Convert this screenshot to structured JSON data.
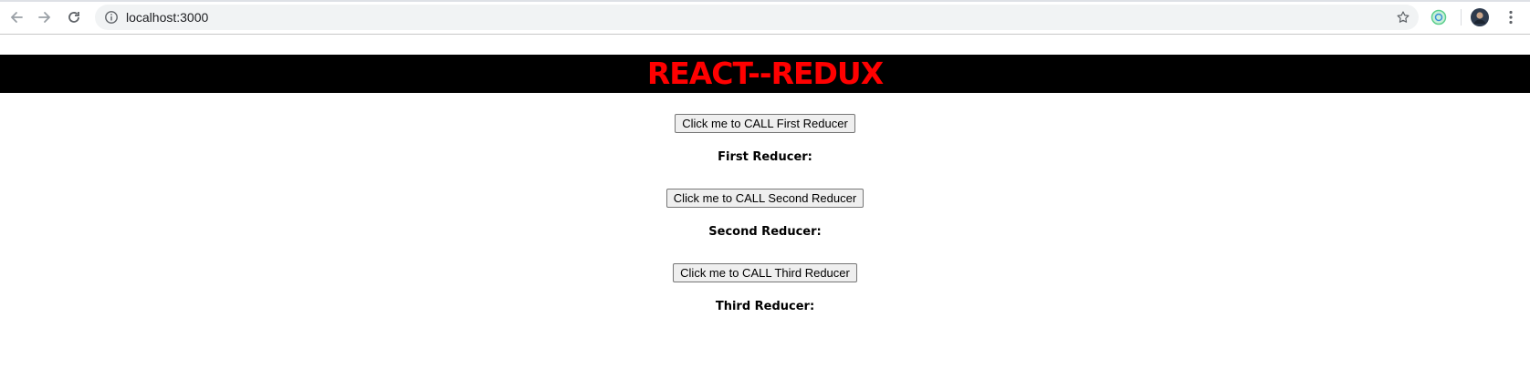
{
  "browser": {
    "url": "localhost:3000",
    "icons": {
      "back": "back-arrow-icon",
      "forward": "forward-arrow-icon",
      "reload": "reload-icon",
      "info": "info-icon",
      "bookmark": "star-icon",
      "extension": "extension-icon",
      "profile": "avatar",
      "menu": "kebab-menu-icon"
    }
  },
  "page": {
    "title": "REACT--REDUX",
    "title_color": "#ff0000",
    "banner_color": "#000000",
    "sections": [
      {
        "button_label": "Click me to CALL First Reducer",
        "result_label": "First Reducer:"
      },
      {
        "button_label": "Click me to CALL Second Reducer",
        "result_label": "Second Reducer:"
      },
      {
        "button_label": "Click me to CALL Third Reducer",
        "result_label": "Third Reducer:"
      }
    ]
  }
}
